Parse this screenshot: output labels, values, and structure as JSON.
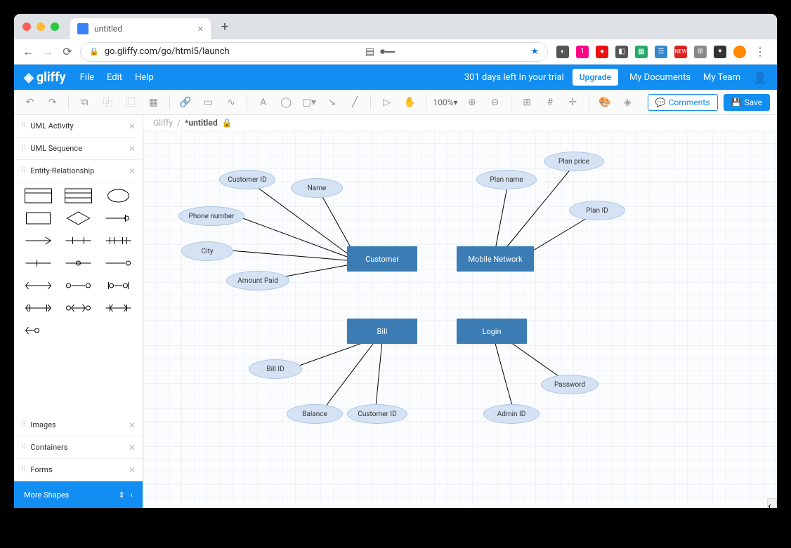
{
  "browser": {
    "tab_title": "untitled",
    "url": "go.gliffy.com/go/html5/launch"
  },
  "blue": {
    "logo": "gliffy",
    "menu": {
      "file": "File",
      "edit": "Edit",
      "help": "Help"
    },
    "trial": "301 days left In your trial",
    "upgrade": "Upgrade",
    "docs": "My Documents",
    "team": "My Team"
  },
  "tool": {
    "zoom": "100%",
    "comments": "Comments",
    "save": "Save"
  },
  "crumb": {
    "root": "Gliffy",
    "doc": "*untitled"
  },
  "side": {
    "cats": {
      "a": "UML Activity",
      "b": "UML Sequence",
      "c": "Entity-Relationship",
      "img": "Images",
      "cont": "Containers",
      "forms": "Forms"
    },
    "more": "More Shapes"
  },
  "diagram": {
    "entities": {
      "customer": "Customer",
      "mobile": "Mobile Network",
      "bill": "Bill",
      "login": "Login"
    },
    "attrs": {
      "customer": {
        "id": "Customer ID",
        "name": "Name",
        "phone": "Phone number",
        "city": "City",
        "paid": "Amount Paid"
      },
      "mobile": {
        "pname": "Plan name",
        "pprice": "Plan price",
        "pid": "Plan ID"
      },
      "bill": {
        "bid": "Bill ID",
        "bal": "Balance",
        "cid": "Customer ID"
      },
      "login": {
        "aid": "Admin ID",
        "pwd": "Password"
      }
    }
  }
}
